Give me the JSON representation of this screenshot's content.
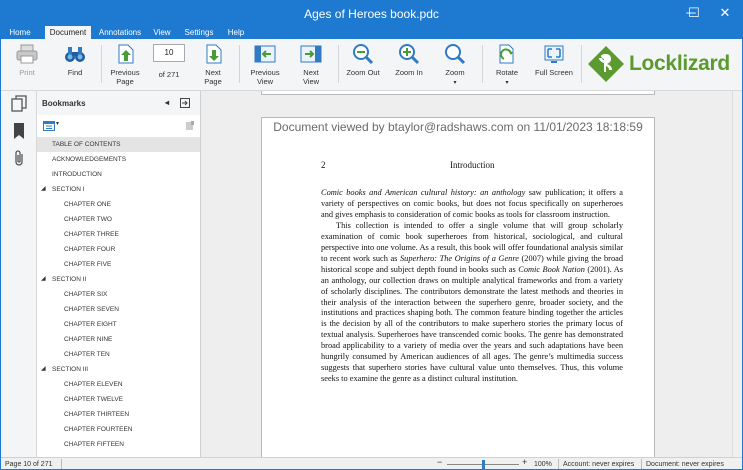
{
  "window": {
    "title": "Ages of Heroes book.pdc",
    "minimize": "─",
    "maximize": "☐",
    "close": "✕"
  },
  "menu": {
    "tabs": [
      "Home",
      "Document",
      "Annotations",
      "View",
      "Settings",
      "Help"
    ],
    "active": "Document"
  },
  "ribbon": {
    "print": "Print",
    "find": "Find",
    "previous_page": [
      "Previous",
      "Page"
    ],
    "page_current": "10",
    "page_total": "of 271",
    "next_page": [
      "Next",
      "Page"
    ],
    "previous_view": [
      "Previous",
      "View"
    ],
    "next_view": [
      "Next",
      "View"
    ],
    "zoom_out": "Zoom Out",
    "zoom_in": "Zoom In",
    "zoom": "Zoom",
    "rotate": "Rotate",
    "full_screen": "Full Screen"
  },
  "logo": {
    "text": "Locklizard",
    "color": "#5b9a2f"
  },
  "bookmarks": {
    "header": "Bookmarks",
    "items": [
      {
        "label": "TABLE OF CONTENTS",
        "level": 0,
        "selected": true
      },
      {
        "label": "ACKNOWLEDGEMENTS",
        "level": 0
      },
      {
        "label": "INTRODUCTION",
        "level": 0
      },
      {
        "label": "SECTION I",
        "level": 0,
        "expanded": true
      },
      {
        "label": "CHAPTER ONE",
        "level": 1
      },
      {
        "label": "CHAPTER TWO",
        "level": 1
      },
      {
        "label": "CHAPTER THREE",
        "level": 1
      },
      {
        "label": "CHAPTER FOUR",
        "level": 1
      },
      {
        "label": "CHAPTER FIVE",
        "level": 1
      },
      {
        "label": "SECTION II",
        "level": 0,
        "expanded": true
      },
      {
        "label": "CHAPTER SIX",
        "level": 1
      },
      {
        "label": "CHAPTER SEVEN",
        "level": 1
      },
      {
        "label": "CHAPTER EIGHT",
        "level": 1
      },
      {
        "label": "CHAPTER NINE",
        "level": 1
      },
      {
        "label": "CHAPTER TEN",
        "level": 1
      },
      {
        "label": "SECTION III",
        "level": 0,
        "expanded": true
      },
      {
        "label": "CHAPTER ELEVEN",
        "level": 1
      },
      {
        "label": "CHAPTER TWELVE",
        "level": 1
      },
      {
        "label": "CHAPTER THIRTEEN",
        "level": 1
      },
      {
        "label": "CHAPTER FOURTEEN",
        "level": 1
      },
      {
        "label": "CHAPTER FIFTEEN",
        "level": 1
      }
    ]
  },
  "document": {
    "watermark": "Document viewed by btaylor@radshaws.com on 11/01/2023 18:18:59",
    "page_number": "2",
    "running_head": "Introduction",
    "paragraphs": [
      [
        {
          "t": "Comic books and American cultural history: an anthology",
          "i": true
        },
        {
          "t": " saw publication; it offers a variety of perspectives on comic books, but does not focus specifically on superheroes and gives emphasis to consideration of comic books as tools for classroom instruction."
        }
      ],
      [
        {
          "t": "This collection is intended to offer a single volume that will group scholarly examination of comic book superheroes from historical, sociological, and cultural perspective into one volume. As a result, this book will offer foundational analysis similar to recent work such as "
        },
        {
          "t": "Superhero: The Origins of a Genre",
          "i": true
        },
        {
          "t": " (2007) while giving the broad historical scope and subject depth found in books such as "
        },
        {
          "t": "Comic Book Nation",
          "i": true
        },
        {
          "t": " (2001). As an anthology, our collection draws on multiple analytical frameworks and from a variety of scholarly disciplines. The contributors demonstrate the latest methods and theories in their analysis of the interaction between the superhero genre, broader society, and the institutions and practices shaping both. The common feature binding together the articles is the decision by all of the contributors to make superhero stories the primary locus of textual analysis. Superheroes have transcended comic books. The genre has demonstrated broad applicability to a variety of media over the years and such adaptations have been hungrily consumed by American audiences of all ages. The genre’s multimedia success suggests that superhero stories have cultural value unto themselves. Thus, this volume seeks to examine the genre as a distinct cultural institution."
        }
      ]
    ]
  },
  "status": {
    "page": "Page 10 of 271",
    "zoom": "100%",
    "zoom_level": 0.5,
    "account": "Account: never expires",
    "doc_expiry": "Document: never expires"
  },
  "colors": {
    "titlebar": "#1e7ad0",
    "accent": "#2f7bc4",
    "ribbon_bg": "#f4f5f7"
  }
}
